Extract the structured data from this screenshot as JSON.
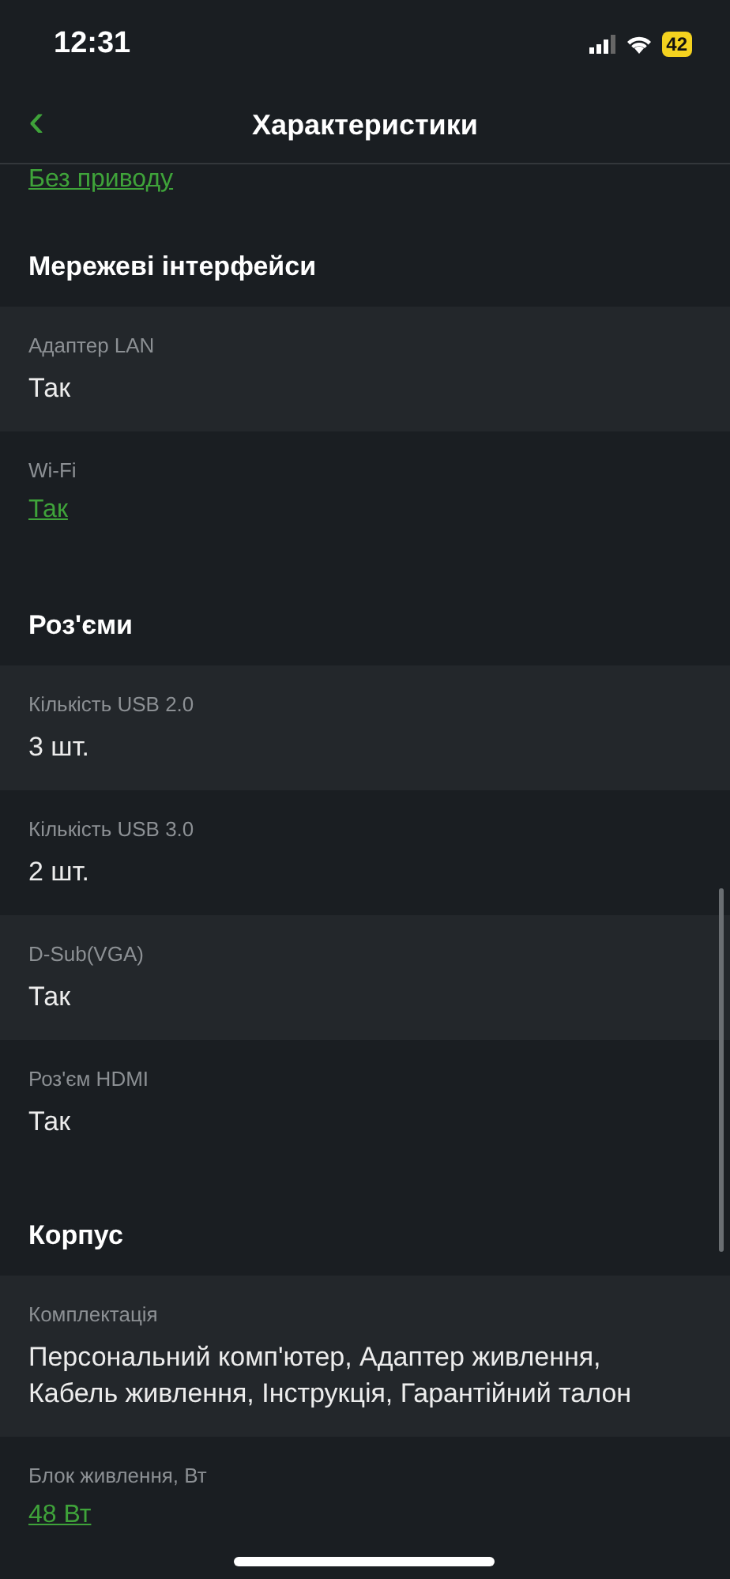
{
  "status_bar": {
    "time": "12:31",
    "battery": "42"
  },
  "header": {
    "back": "‹",
    "title": "Характеристики"
  },
  "top_value": {
    "text": "Без приводу",
    "link": true
  },
  "sections": [
    {
      "title": "Мережеві інтерфейси",
      "rows": [
        {
          "label": "Адаптер LAN",
          "value": "Так",
          "link": false
        },
        {
          "label": "Wi-Fi",
          "value": "Так",
          "link": true
        }
      ]
    },
    {
      "title": "Роз'єми",
      "rows": [
        {
          "label": "Кількість USB 2.0",
          "value": "3 шт.",
          "link": false
        },
        {
          "label": "Кількість USB 3.0",
          "value": "2 шт.",
          "link": false
        },
        {
          "label": "D-Sub(VGA)",
          "value": "Так",
          "link": false
        },
        {
          "label": "Роз'єм HDMI",
          "value": "Так",
          "link": false
        }
      ]
    },
    {
      "title": "Корпус",
      "rows": [
        {
          "label": "Комплектація",
          "value": "Персональний комп'ютер, Адаптер живлення, Кабель живлення, Інструкція, Гарантійний талон",
          "link": false
        },
        {
          "label": "Блок живлення, Вт",
          "value": "48 Вт",
          "link": true
        }
      ]
    }
  ]
}
